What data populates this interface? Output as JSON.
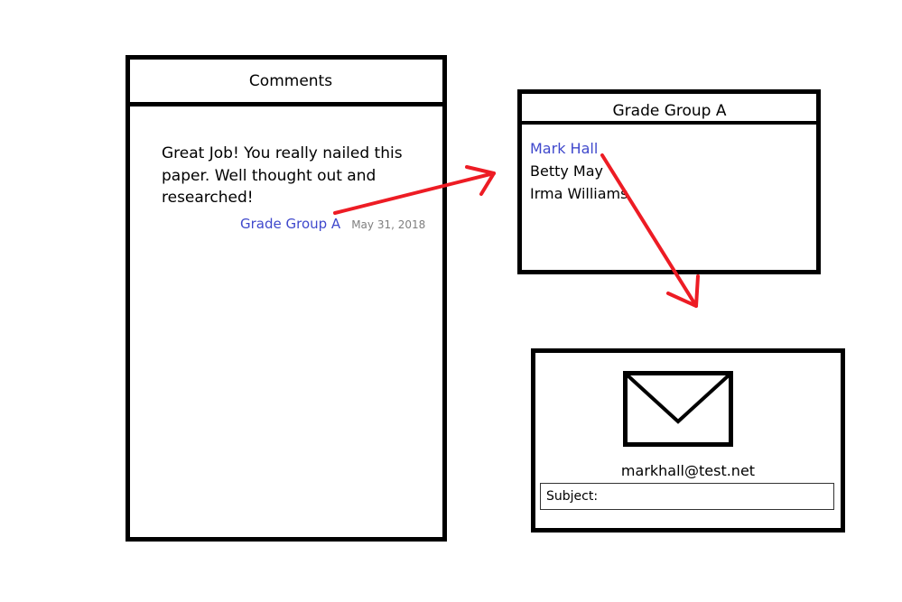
{
  "comments": {
    "title": "Comments",
    "comment": {
      "text": "Great Job! You really nailed this paper. Well thought out and researched!",
      "group_label": "Grade Group A",
      "date": "May 31, 2018"
    }
  },
  "group": {
    "title": "Grade Group A",
    "members": [
      {
        "name": "Mark Hall"
      },
      {
        "name": "Betty May"
      },
      {
        "name": "Irma Williams"
      }
    ]
  },
  "email": {
    "icon": "envelope-icon",
    "address": "markhall@test.net",
    "subject_label": "Subject:"
  },
  "colors": {
    "link": "#3f48cc",
    "arrow": "#ed1c24",
    "border": "#000000",
    "date": "#7f7f7f"
  }
}
